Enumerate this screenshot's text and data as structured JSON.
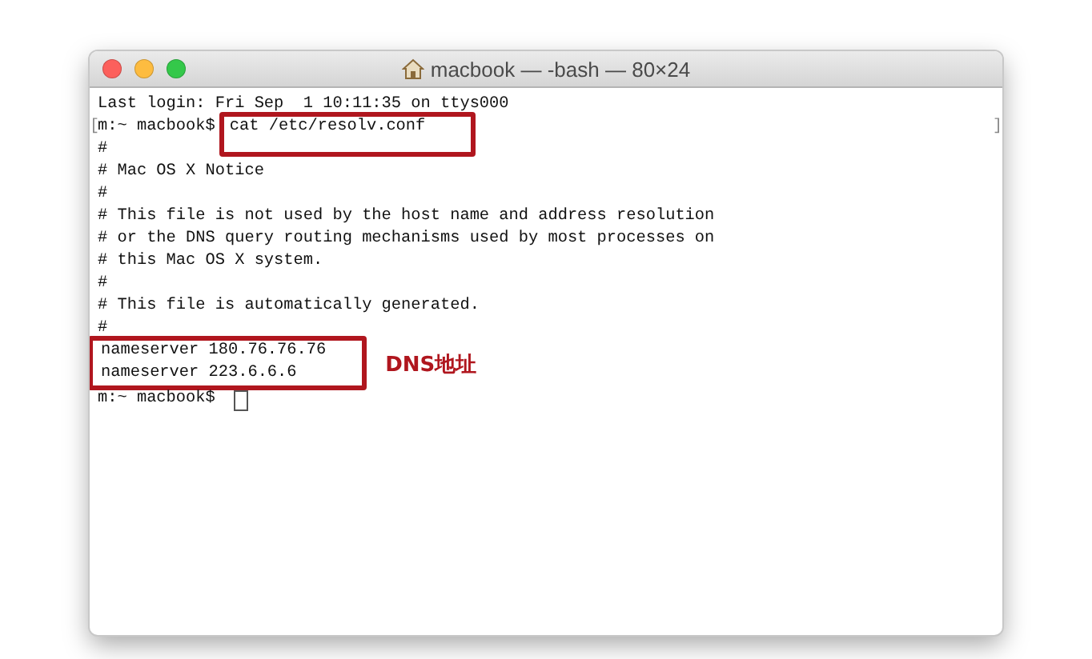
{
  "window": {
    "title": "macbook — -bash — 80×24"
  },
  "terminal": {
    "lines": [
      {
        "kind": "text",
        "text": "Last login: Fri Sep  1 10:11:35 on ttys000"
      },
      {
        "kind": "prompt",
        "prompt": "m:~ macbook$",
        "command": "cat /etc/resolv.conf",
        "highlighted": true,
        "marks": {
          "left": "[",
          "right": "]"
        }
      },
      {
        "kind": "text",
        "text": "#"
      },
      {
        "kind": "text",
        "text": "# Mac OS X Notice"
      },
      {
        "kind": "text",
        "text": "#"
      },
      {
        "kind": "text",
        "text": "# This file is not used by the host name and address resolution"
      },
      {
        "kind": "text",
        "text": "# or the DNS query routing mechanisms used by most processes on"
      },
      {
        "kind": "text",
        "text": "# this Mac OS X system."
      },
      {
        "kind": "text",
        "text": "#"
      },
      {
        "kind": "text",
        "text": "# This file is automatically generated."
      },
      {
        "kind": "text",
        "text": "#"
      },
      {
        "kind": "group",
        "highlighted": true,
        "annotation": "DNS地址",
        "lines": [
          "nameserver 180.76.76.76",
          "nameserver 223.6.6.6"
        ]
      },
      {
        "kind": "prompt",
        "prompt": "m:~ macbook$",
        "cursor": true
      }
    ]
  }
}
